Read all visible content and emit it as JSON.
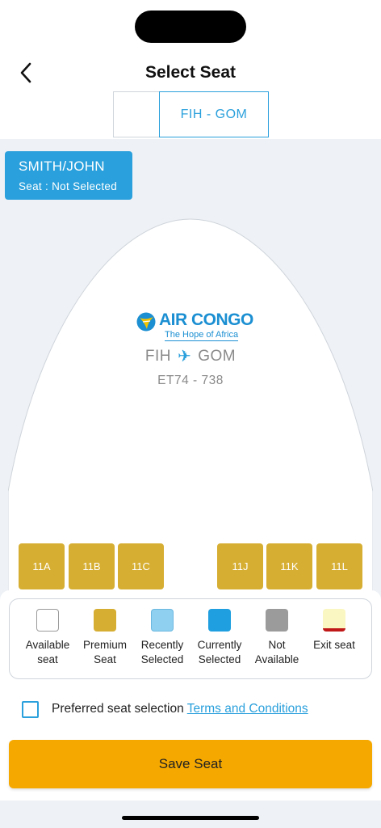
{
  "header": {
    "title": "Select Seat",
    "back_icon": "chevron-left-icon"
  },
  "segments": [
    {
      "label": ""
    },
    {
      "label": "FIH - GOM",
      "active": true
    }
  ],
  "passenger": {
    "name": "SMITH/JOHN",
    "status": "Seat : Not Selected"
  },
  "airline": {
    "name": "AIR CONGO",
    "tagline": "The Hope of Africa",
    "origin": "FIH",
    "destination": "GOM",
    "flight": "ET74 - 738"
  },
  "seats": [
    {
      "label": "11A"
    },
    {
      "label": "11B"
    },
    {
      "label": "11C"
    },
    {
      "label": "11J"
    },
    {
      "label": "11K"
    },
    {
      "label": "11L"
    }
  ],
  "legend": [
    {
      "label": "Available\nseat",
      "color": "#ffffff"
    },
    {
      "label": "Premium\nSeat",
      "color": "#d6ae32"
    },
    {
      "label": "Recently\nSelected",
      "color": "#8fd0f0"
    },
    {
      "label": "Currently\nSelected",
      "color": "#1f9fe0"
    },
    {
      "label": "Not\nAvailable",
      "color": "#9b9b9b"
    },
    {
      "label": "Exit seat",
      "color": "#fbf7c2"
    }
  ],
  "preference": {
    "text": "Preferred seat selection",
    "link": "Terms and Conditions"
  },
  "actions": {
    "save_label": "Save Seat"
  },
  "colors": {
    "accent": "#2aa0dc",
    "save": "#f5a800",
    "premium": "#d6ae32"
  }
}
